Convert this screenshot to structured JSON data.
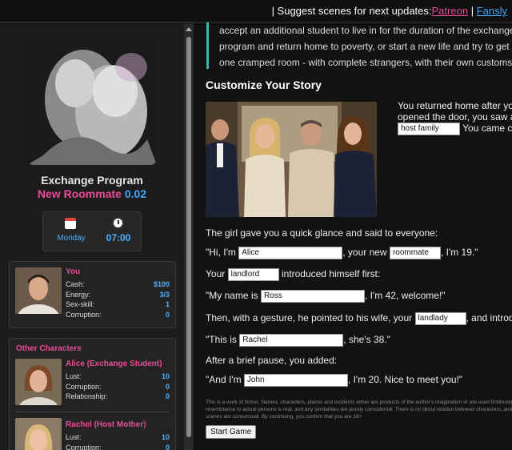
{
  "topbar": {
    "prefix": "| Suggest scenes for next updates:",
    "patreon": "Patreon",
    "separator": "|",
    "fansly": "Fansly"
  },
  "sidebar": {
    "game_title": "Exchange Program",
    "game_subtitle_name": "New Roommate",
    "game_subtitle_version": "0.02",
    "day": "Monday",
    "time": "07:00",
    "player": {
      "name": "You",
      "stats": [
        {
          "label": "Cash:",
          "value": "$100"
        },
        {
          "label": "Energy:",
          "value": "3/3"
        },
        {
          "label": "Sex-skill:",
          "value": "1"
        },
        {
          "label": "Corruption:",
          "value": "0"
        }
      ]
    },
    "others_title": "Other Characters",
    "characters": [
      {
        "name": "Alice (Exchange Student)",
        "stats": [
          {
            "label": "Lust:",
            "value": "10"
          },
          {
            "label": "Corruption:",
            "value": "0"
          },
          {
            "label": "Relationship:",
            "value": "0"
          }
        ]
      },
      {
        "name": "Rachel (Host Mother)",
        "stats": [
          {
            "label": "Lust:",
            "value": "10"
          },
          {
            "label": "Corruption:",
            "value": "0"
          }
        ]
      }
    ]
  },
  "main": {
    "intro_lines": [
      "accept an additional student to live in for the duration of the exchange.",
      "program and return home to poverty, or start a new life and try to get al",
      "one cramped room - with complete strangers, with their own customs a"
    ],
    "heading": "Customize Your Story",
    "side_lines": [
      "You returned home after yo",
      "opened the door, you saw a",
      "You came c"
    ],
    "host_family_value": "host family",
    "line_glance": "The girl gave you a quick glance and said to everyone:",
    "hi_prefix": "\"Hi, I'm",
    "girl_name": "Alice",
    "hi_mid": ", your new",
    "roommate_value": "roommate",
    "hi_suffix": ", I'm 19.\"",
    "your_prefix": "Your",
    "landlord_value": "landlord",
    "your_suffix": "introduced himself first:",
    "myname_prefix": "\"My name is",
    "landlord_name": "Ross",
    "myname_suffix": ", I'm 42, welcome!\"",
    "then_prefix": "Then, with a gesture, he pointed to his wife, your",
    "landlady_value": "landlady",
    "then_suffix": ", and introdu",
    "this_prefix": "\"This is",
    "landlady_name": "Rachel",
    "this_suffix": ", she's 38.\"",
    "pause": "After a brief pause, you added:",
    "andim_prefix": "\"And I'm",
    "player_name": "John",
    "andim_suffix": ", I'm 20. Nice to meet you!\"",
    "disclaimer": "This is a work of fiction. Names, characters, places and incidents either are products of the author's imagination or are used fictitiously. Any resemblance to actual persons is real, and any similarities are purely coincidental. There is no blood relation between characters, and all scenes are consensual. By continuing, you confirm that you are 18+",
    "start_button": "Start Game"
  },
  "colors": {
    "accent_pink": "#e64c98",
    "accent_blue": "#3fa6ff",
    "quote_bar": "#3fb6b0"
  }
}
